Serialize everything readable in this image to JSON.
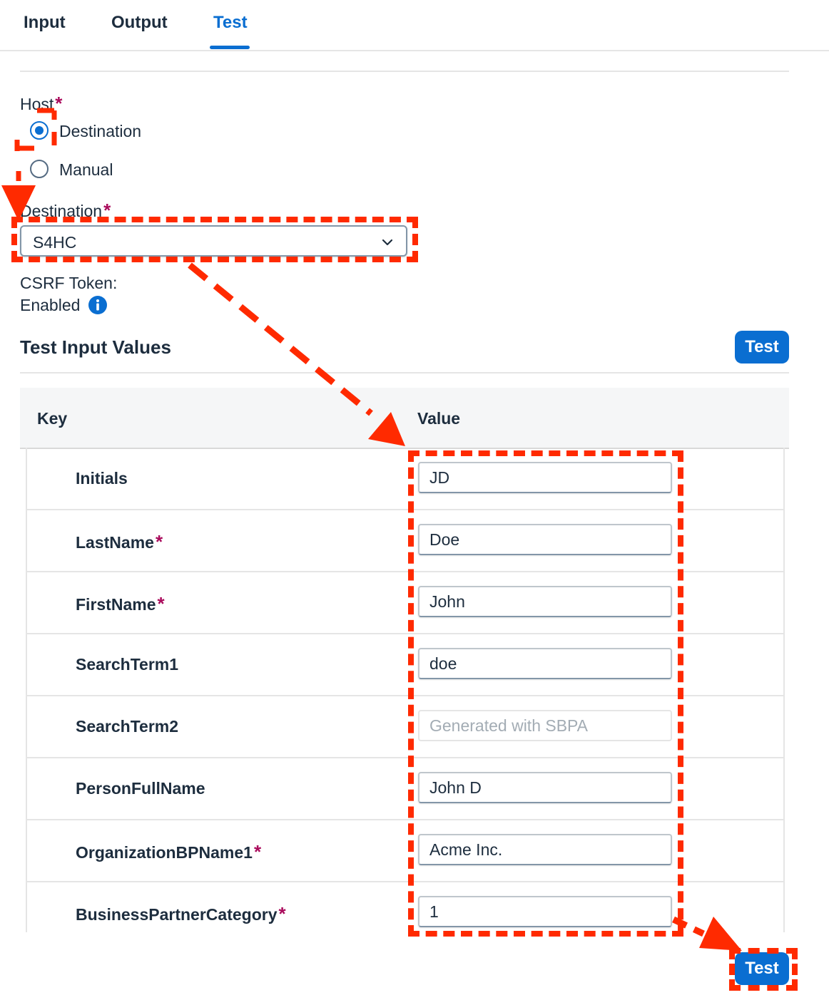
{
  "tabs": [
    {
      "label": "Input",
      "active": false
    },
    {
      "label": "Output",
      "active": false
    },
    {
      "label": "Test",
      "active": true
    }
  ],
  "host": {
    "label": "Host",
    "options": [
      {
        "label": "Destination",
        "selected": true
      },
      {
        "label": "Manual",
        "selected": false
      }
    ]
  },
  "destination": {
    "label": "Destination",
    "value": "S4HC"
  },
  "csrf": {
    "label": "CSRF Token:",
    "value": "Enabled"
  },
  "test_input": {
    "title": "Test Input Values",
    "test_button": "Test",
    "columns": {
      "key": "Key",
      "value": "Value"
    },
    "rows": [
      {
        "key": "Initials",
        "required": false,
        "value": "JD",
        "placeholder": ""
      },
      {
        "key": "LastName",
        "required": true,
        "value": "Doe",
        "placeholder": ""
      },
      {
        "key": "FirstName",
        "required": true,
        "value": "John",
        "placeholder": ""
      },
      {
        "key": "SearchTerm1",
        "required": false,
        "value": "doe",
        "placeholder": ""
      },
      {
        "key": "SearchTerm2",
        "required": false,
        "value": "",
        "placeholder": "Generated with SBPA"
      },
      {
        "key": "PersonFullName",
        "required": false,
        "value": "John D",
        "placeholder": ""
      },
      {
        "key": "OrganizationBPName1",
        "required": true,
        "value": "Acme Inc.",
        "placeholder": ""
      },
      {
        "key": "BusinessPartnerCategory",
        "required": true,
        "value": "1",
        "placeholder": ""
      }
    ]
  },
  "bottom_test_button": "Test",
  "required_marker": "*",
  "colors": {
    "accent": "#0a6ed1",
    "required": "#aa0b5c",
    "annotation": "#ff2a00"
  }
}
